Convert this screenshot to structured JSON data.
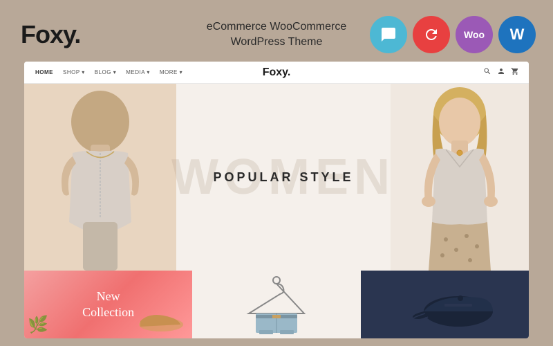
{
  "header": {
    "logo": "Foxy.",
    "subtitle_line1": "eCommerce WooCommerce",
    "subtitle_line2": "WordPress Theme"
  },
  "icons": {
    "chat": "💬",
    "refresh": "🔄",
    "woo": "Woo",
    "wordpress": "W"
  },
  "nav": {
    "logo": "Foxy.",
    "items": [
      {
        "label": "HOME"
      },
      {
        "label": "SHOP ▾"
      },
      {
        "label": "BLOG ▾"
      },
      {
        "label": "MEDIA ▾"
      },
      {
        "label": "MORE ▾"
      }
    ],
    "icons": [
      "🔍",
      "👤",
      "🛒"
    ]
  },
  "hero": {
    "bg_text": "WOMEN",
    "headline": "POPULAR STYLE"
  },
  "bottom": {
    "new_collection_line1": "New",
    "new_collection_line2": "Collection"
  }
}
